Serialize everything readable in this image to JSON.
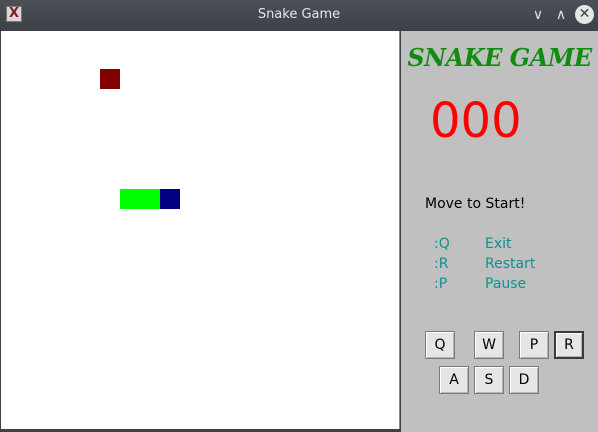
{
  "window": {
    "title": "Snake Game",
    "app_icon_glyph": "X",
    "minimize_glyph": "∨",
    "maximize_glyph": "∧",
    "close_glyph": "✕"
  },
  "board": {
    "food_color": "#800000",
    "snake_body_color": "#00ff00",
    "snake_head_color": "#000080"
  },
  "panel": {
    "title": "SNAKE GAME",
    "score": "000",
    "status": "Move to Start!",
    "shortcuts": [
      {
        "key": ":Q",
        "action": "Exit"
      },
      {
        "key": ":R",
        "action": "Restart"
      },
      {
        "key": ":P",
        "action": "Pause"
      }
    ],
    "buttons": [
      "Q",
      "W",
      "P",
      "R",
      "A",
      "S",
      "D"
    ]
  }
}
